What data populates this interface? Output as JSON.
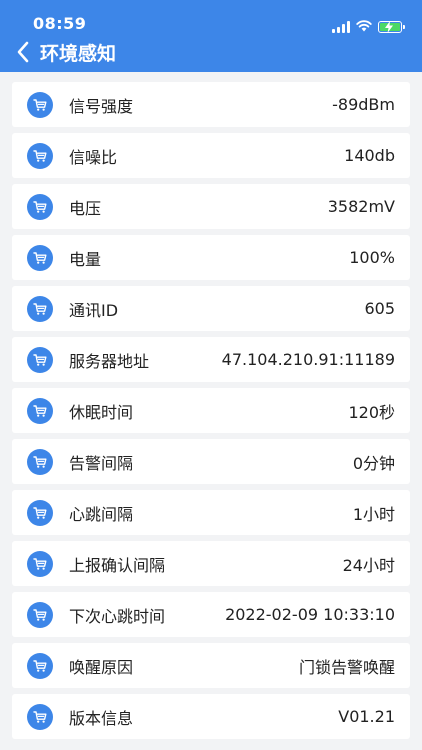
{
  "status_bar": {
    "time": "08:59"
  },
  "header": {
    "title": "环境感知",
    "background_color": "#3d86e8"
  },
  "icons": {
    "back": "chevron-left-icon",
    "row_icon": "cart-icon",
    "signal": "cellular-signal-icon",
    "wifi": "wifi-icon",
    "battery": "battery-charging-icon"
  },
  "items": [
    {
      "label": "信号强度",
      "value": "-89dBm"
    },
    {
      "label": "信噪比",
      "value": "140db"
    },
    {
      "label": "电压",
      "value": "3582mV"
    },
    {
      "label": "电量",
      "value": "100%"
    },
    {
      "label": "通讯ID",
      "value": "605"
    },
    {
      "label": "服务器地址",
      "value": "47.104.210.91:11189"
    },
    {
      "label": "休眠时间",
      "value": "120秒"
    },
    {
      "label": "告警间隔",
      "value": "0分钟"
    },
    {
      "label": "心跳间隔",
      "value": "1小时"
    },
    {
      "label": "上报确认间隔",
      "value": "24小时"
    },
    {
      "label": "下次心跳时间",
      "value": "2022-02-09 10:33:10"
    },
    {
      "label": "唤醒原因",
      "value": "门锁告警唤醒"
    },
    {
      "label": "版本信息",
      "value": "V01.21"
    }
  ]
}
